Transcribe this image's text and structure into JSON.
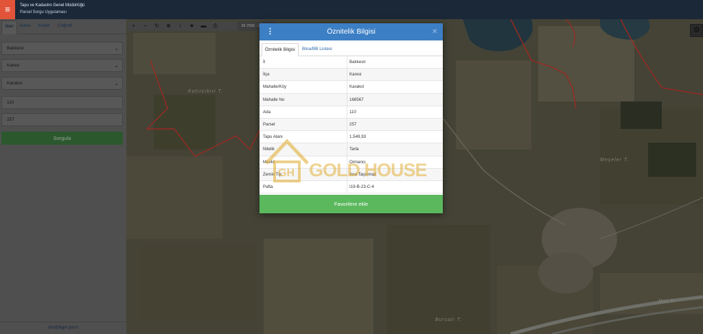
{
  "header": {
    "menu_icon": "hamburger-icon",
    "title": "Tapu ve Kadastro Genel Müdürlüğü",
    "subtitle": "Parsel Sorgu Uygulaması"
  },
  "sidebar": {
    "tabs": [
      {
        "label": "İdari"
      },
      {
        "label": "Adres"
      },
      {
        "label": "Analiz"
      },
      {
        "label": "Coğrafi"
      }
    ],
    "province": "Balıkesir",
    "district": "Karesi",
    "neighborhood": "Karakol",
    "block": "110",
    "parcel": "257",
    "query_button": "Sorgula",
    "footer_email": "cbs@tkgm.gov.tr"
  },
  "map": {
    "coordinates": "39.7665 - 27.8797",
    "labels": {
      "kucuk": "Kutırcıkıri T.",
      "meseler": "Meşeler T.",
      "bursali": "Bursalı T.",
      "mol": "Mol T."
    }
  },
  "modal": {
    "title": "Öznitelik Bilgisi",
    "tabs": [
      "Öznitelik Bilgisi",
      "Bina/BB Listesi"
    ],
    "rows": [
      {
        "key": "İl",
        "value": "Balıkesir"
      },
      {
        "key": "İlçe",
        "value": "Karesi"
      },
      {
        "key": "Mahalle/Köy",
        "value": "Karakol"
      },
      {
        "key": "Mahalle No",
        "value": "168567"
      },
      {
        "key": "Ada",
        "value": "110"
      },
      {
        "key": "Parsel",
        "value": "257"
      },
      {
        "key": "Tapu Alanı",
        "value": "1.549,93"
      },
      {
        "key": "Nitelik",
        "value": "Tarla"
      },
      {
        "key": "Mevkii",
        "value": "Ormancı"
      },
      {
        "key": "Zemin Tip",
        "value": "Ana Taşınmaz"
      },
      {
        "key": "Pafta",
        "value": "I19-B-23-C-4"
      }
    ],
    "favorite_button": "Favorilere ekle"
  },
  "watermark": {
    "text": "GOLD HOUSE",
    "logo_letters": "GH"
  },
  "colors": {
    "header_bg": "#1b2838",
    "menu_accent": "#e2543a",
    "modal_header": "#3c7fc4",
    "button_green": "#5bb85d",
    "parcel_border": "#d73a2e"
  }
}
